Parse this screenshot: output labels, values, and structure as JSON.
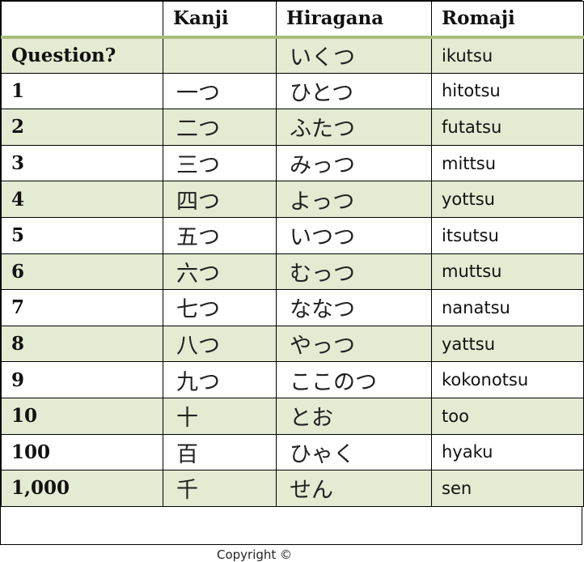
{
  "headers": {
    "number": "",
    "kanji": "Kanji",
    "hiragana": "Hiragana",
    "romaji": "Romaji"
  },
  "rows": [
    {
      "number": "Question?",
      "kanji": "",
      "hiragana": "いくつ",
      "romaji": "ikutsu"
    },
    {
      "number": "1",
      "kanji": "一つ",
      "hiragana": "ひとつ",
      "romaji": "hitotsu"
    },
    {
      "number": "2",
      "kanji": "二つ",
      "hiragana": "ふたつ",
      "romaji": "futatsu"
    },
    {
      "number": "3",
      "kanji": "三つ",
      "hiragana": "みっつ",
      "romaji": "mittsu"
    },
    {
      "number": "4",
      "kanji": "四つ",
      "hiragana": "よっつ",
      "romaji": "yottsu"
    },
    {
      "number": "5",
      "kanji": "五つ",
      "hiragana": "いつつ",
      "romaji": "itsutsu"
    },
    {
      "number": "6",
      "kanji": "六つ",
      "hiragana": "むっつ",
      "romaji": "muttsu"
    },
    {
      "number": "7",
      "kanji": "七つ",
      "hiragana": "ななつ",
      "romaji": "nanatsu"
    },
    {
      "number": "8",
      "kanji": "八つ",
      "hiragana": "やっつ",
      "romaji": "yattsu"
    },
    {
      "number": "9",
      "kanji": "九つ",
      "hiragana": "ここのつ",
      "romaji": "kokonotsu"
    },
    {
      "number": "10",
      "kanji": "十",
      "hiragana": "とお",
      "romaji": "too"
    },
    {
      "number": "100",
      "kanji": "百",
      "hiragana": "ひゃく",
      "romaji": "hyaku"
    },
    {
      "number": "1,000",
      "kanji": "千",
      "hiragana": "せん",
      "romaji": "sen"
    }
  ],
  "footer": {
    "copyright": "Copyright ©"
  },
  "colors": {
    "header_rule": "#a9bd7c",
    "alt_row": "#e3ebd2",
    "border": "#000000"
  }
}
